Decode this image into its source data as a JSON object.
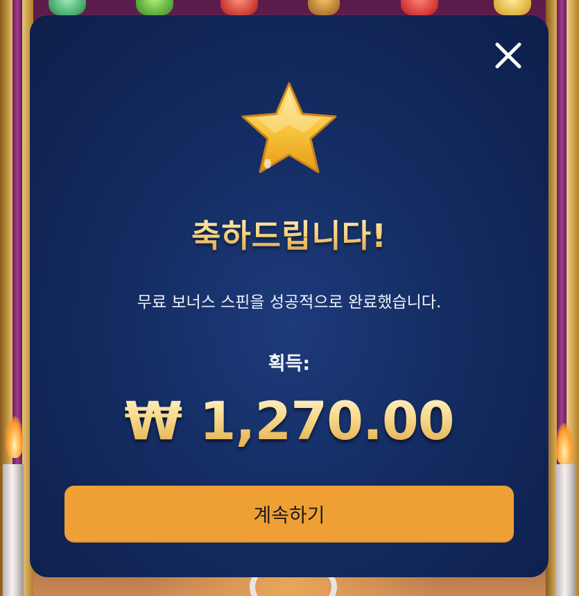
{
  "dialog": {
    "close_icon": "close-icon",
    "star_icon": "star-icon",
    "title": "축하드립니다!",
    "message": "무료 보너스 스핀을 성공적으로 완료했습니다.",
    "won_label": "획득:",
    "amount": "₩ 1,270.00",
    "continue_label": "계속하기"
  },
  "colors": {
    "modal_bg": "#142c62",
    "accent_gold": "#f4cf78",
    "button": "#efa035"
  }
}
